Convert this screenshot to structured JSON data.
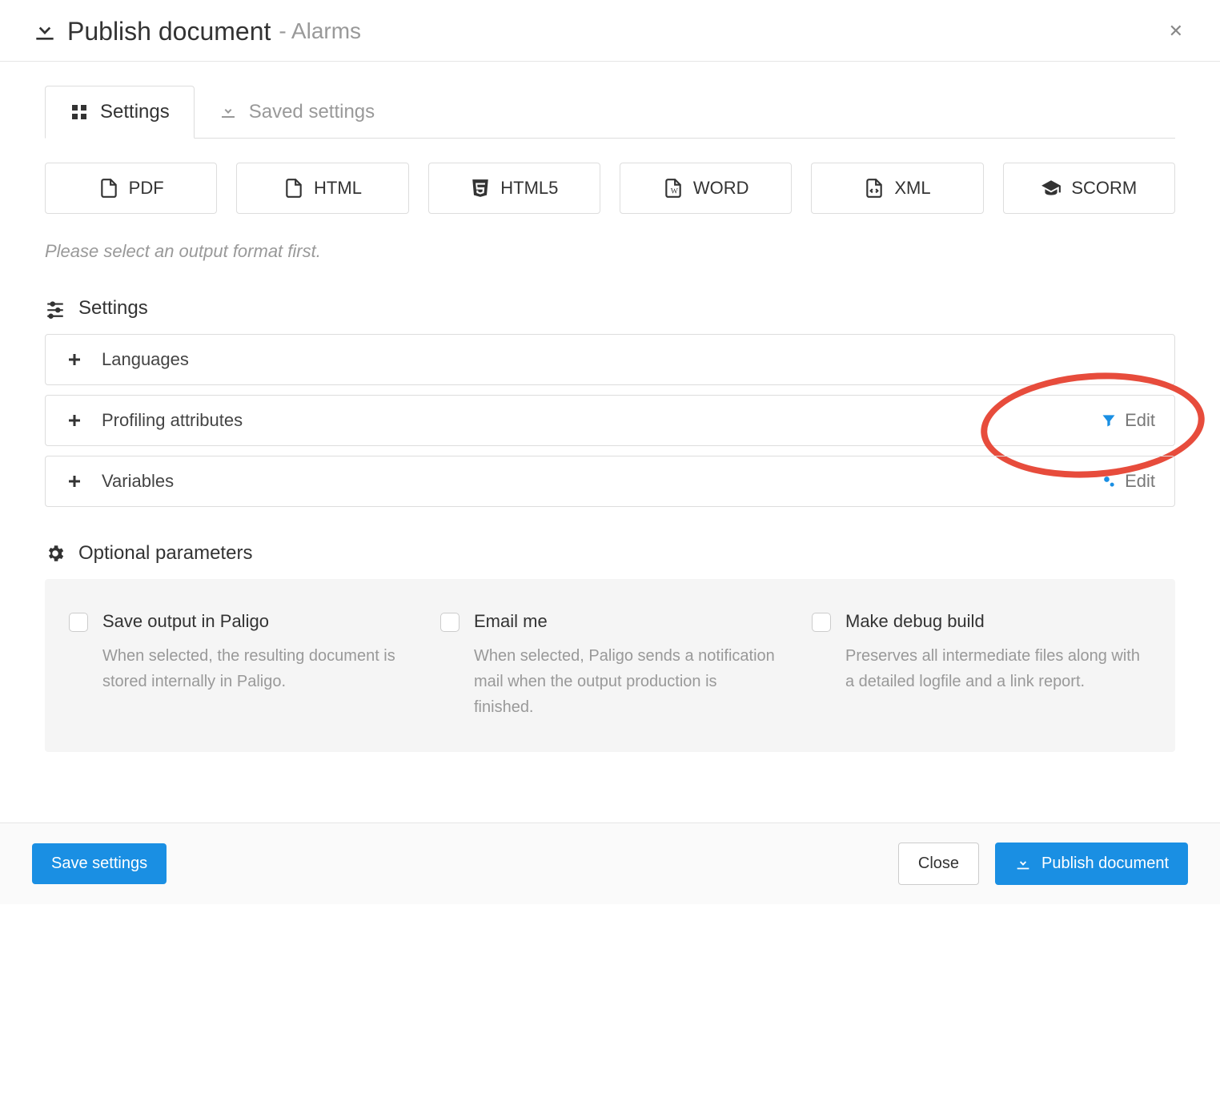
{
  "header": {
    "title": "Publish document",
    "subtitle": "- Alarms"
  },
  "tabs": [
    {
      "label": "Settings",
      "active": true
    },
    {
      "label": "Saved settings",
      "active": false
    }
  ],
  "formats": [
    {
      "label": "PDF"
    },
    {
      "label": "HTML"
    },
    {
      "label": "HTML5"
    },
    {
      "label": "WORD"
    },
    {
      "label": "XML"
    },
    {
      "label": "SCORM"
    }
  ],
  "hint": "Please select an output format first.",
  "settings_section": {
    "heading": "Settings",
    "rows": [
      {
        "label": "Languages",
        "edit": null
      },
      {
        "label": "Profiling attributes",
        "edit": "Edit",
        "highlighted": true
      },
      {
        "label": "Variables",
        "edit": "Edit"
      }
    ]
  },
  "optional_section": {
    "heading": "Optional parameters",
    "options": [
      {
        "title": "Save output in Paligo",
        "desc": "When selected, the resulting document is stored internally in Paligo."
      },
      {
        "title": "Email me",
        "desc": "When selected, Paligo sends a notification mail when the output production is finished."
      },
      {
        "title": "Make debug build",
        "desc": "Preserves all intermediate files along with a detailed logfile and a link report."
      }
    ]
  },
  "footer": {
    "save_settings": "Save settings",
    "close": "Close",
    "publish": "Publish document"
  }
}
